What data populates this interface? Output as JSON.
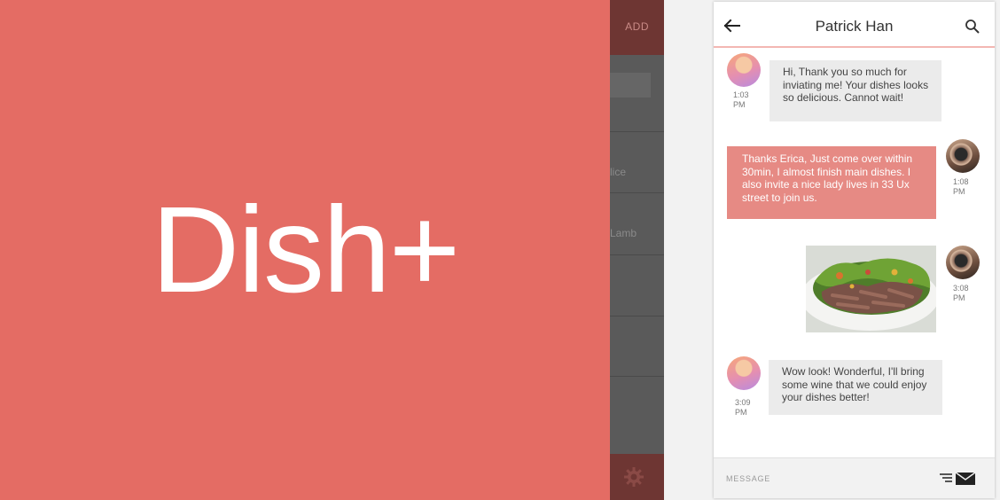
{
  "splash": {
    "brand": "Dish+",
    "color": "#e46c64"
  },
  "bg_screen": {
    "add_label": "ADD",
    "items": [
      "lice",
      "Lamb"
    ]
  },
  "chat": {
    "header": {
      "title": "Patrick Han",
      "back_icon": "back-arrow-icon",
      "search_icon": "search-icon"
    },
    "messages": [
      {
        "from": "Patrick Han",
        "direction": "incoming",
        "text": "Hi, Thank you so much for inviating me! Your dishes looks so delicious. Cannot wait!",
        "time": "1:03 PM"
      },
      {
        "from": "me",
        "direction": "outgoing",
        "text": "Thanks Erica, Just come over within 30min, I almost finish main dishes. I also invite a nice lady lives in 33 Ux street to join us.",
        "time": "1:08 PM"
      },
      {
        "from": "me",
        "direction": "outgoing",
        "type": "image",
        "image": "steak-salad-photo",
        "time": "3:08 PM"
      },
      {
        "from": "Patrick Han",
        "direction": "incoming",
        "text": "Wow look! Wonderful, I'll bring some wine that we could enjoy your dishes better!",
        "time": "3:09 PM"
      }
    ],
    "composer": {
      "placeholder": "MESSAGE",
      "send_icon": "send-mail-icon"
    },
    "colors": {
      "accent": "#e68a84",
      "incoming_bubble": "#ebebeb",
      "header_border": "#f3b7b2"
    }
  }
}
